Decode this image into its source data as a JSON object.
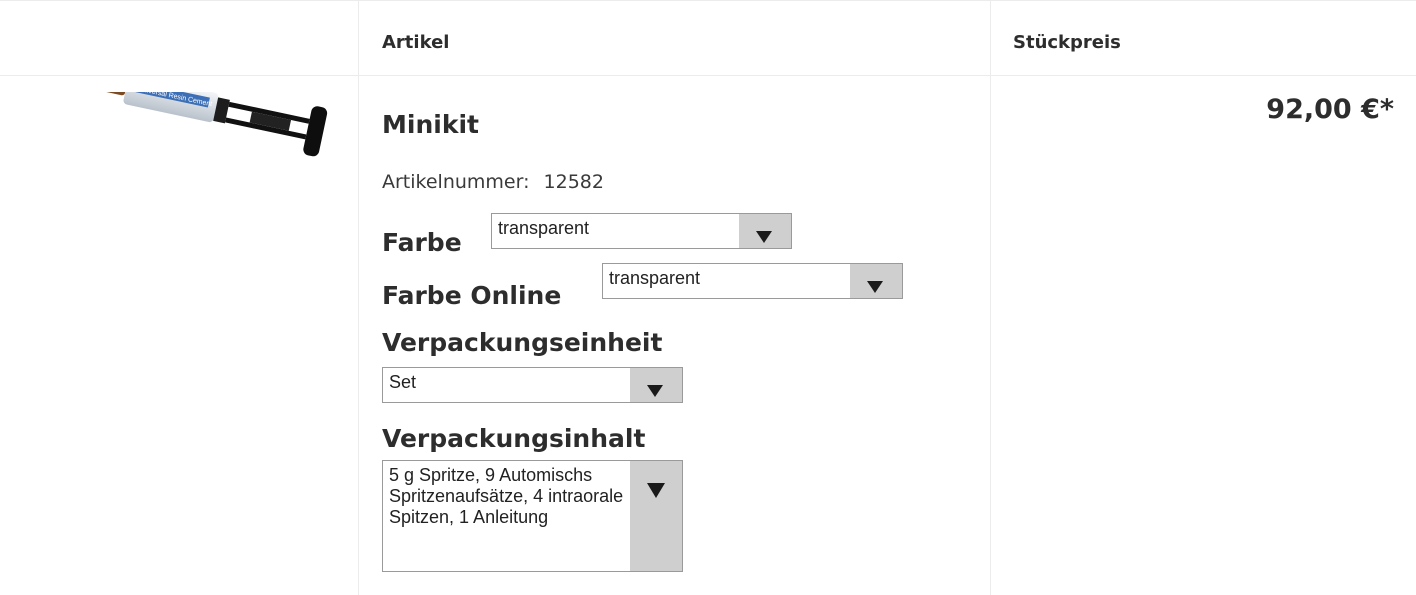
{
  "table": {
    "col_artikel": "Artikel",
    "col_price": "Stückpreis"
  },
  "item": {
    "name": "Minikit",
    "article_number_label": "Artikelnummer:",
    "article_number": "12582",
    "price": "92,00 €*",
    "image_alt": "Universal Resin Cement syringe"
  },
  "options": {
    "farbe": {
      "label": "Farbe",
      "value": "transparent"
    },
    "farbe_online": {
      "label": "Farbe Online",
      "value": "transparent"
    },
    "verpackungseinheit": {
      "label": "Verpackungseinheit",
      "value": "Set"
    },
    "verpackungsinhalt": {
      "label": "Verpackungsinhalt",
      "value": "5 g Spritze, 9 Automischs Spritzenaufsätze, 4 intraorale Spitzen, 1 Anleitung"
    }
  },
  "image_text": "Universal Resin Cement",
  "icons": {
    "dropdown": "chevron-down-icon"
  }
}
